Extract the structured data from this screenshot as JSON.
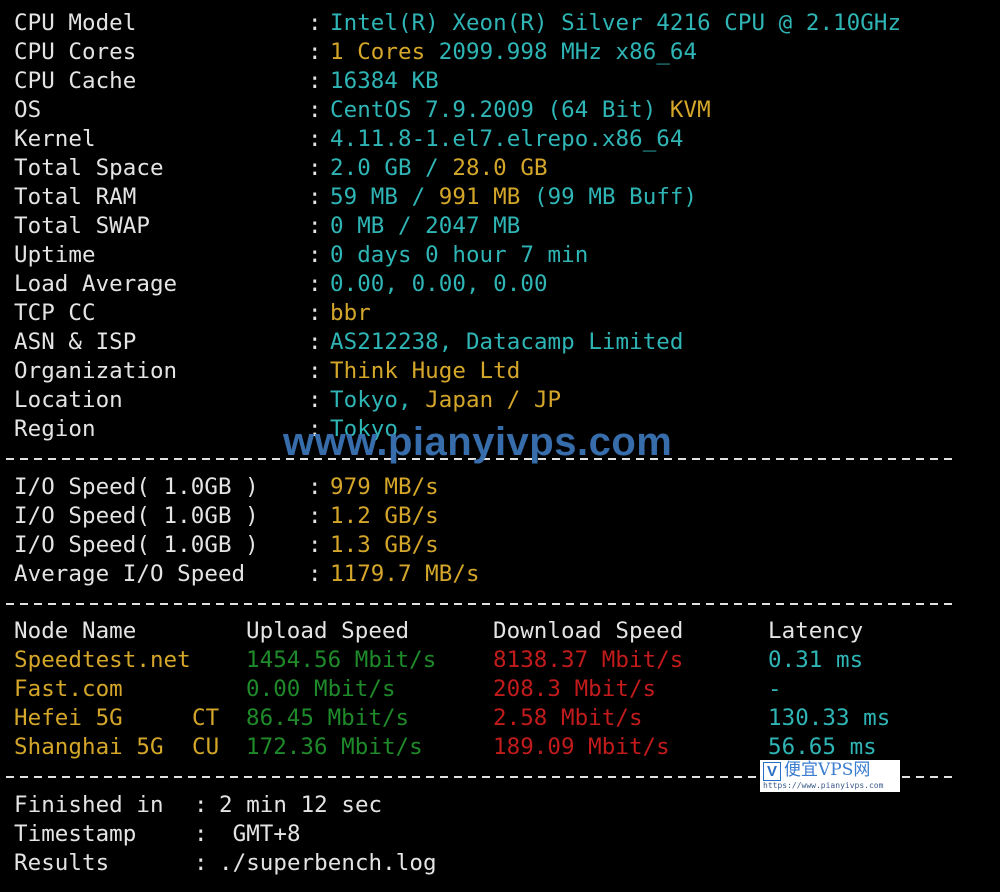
{
  "system_info": [
    {
      "label": "CPU Model",
      "parts": [
        {
          "text": "Intel(R) Xeon(R) Silver 4216 CPU @ 2.10GHz",
          "color": "cyan"
        }
      ]
    },
    {
      "label": "CPU Cores",
      "parts": [
        {
          "text": "1 Cores ",
          "color": "yellow"
        },
        {
          "text": "2099.998 MHz x86_64",
          "color": "cyan"
        }
      ]
    },
    {
      "label": "CPU Cache",
      "parts": [
        {
          "text": "16384 KB",
          "color": "cyan"
        }
      ]
    },
    {
      "label": "OS",
      "parts": [
        {
          "text": "CentOS 7.9.2009 (64 Bit) ",
          "color": "cyan"
        },
        {
          "text": "KVM",
          "color": "yellow"
        }
      ]
    },
    {
      "label": "Kernel",
      "parts": [
        {
          "text": "4.11.8-1.el7.elrepo.x86_64",
          "color": "cyan"
        }
      ]
    },
    {
      "label": "Total Space",
      "parts": [
        {
          "text": "2.0 GB / ",
          "color": "cyan"
        },
        {
          "text": "28.0 GB",
          "color": "yellow"
        }
      ]
    },
    {
      "label": "Total RAM",
      "parts": [
        {
          "text": "59 MB / ",
          "color": "cyan"
        },
        {
          "text": "991 MB ",
          "color": "yellow"
        },
        {
          "text": "(99 MB Buff)",
          "color": "cyan"
        }
      ]
    },
    {
      "label": "Total SWAP",
      "parts": [
        {
          "text": "0 MB / 2047 MB",
          "color": "cyan"
        }
      ]
    },
    {
      "label": "Uptime",
      "parts": [
        {
          "text": "0 days 0 hour 7 min",
          "color": "cyan"
        }
      ]
    },
    {
      "label": "Load Average",
      "parts": [
        {
          "text": "0.00, 0.00, 0.00",
          "color": "cyan"
        }
      ]
    },
    {
      "label": "TCP CC",
      "parts": [
        {
          "text": "bbr",
          "color": "yellow"
        }
      ]
    },
    {
      "label": "ASN & ISP",
      "parts": [
        {
          "text": "AS212238, Datacamp Limited",
          "color": "cyan"
        }
      ]
    },
    {
      "label": "Organization",
      "parts": [
        {
          "text": "Think Huge Ltd",
          "color": "yellow"
        }
      ]
    },
    {
      "label": "Location",
      "parts": [
        {
          "text": "Tokyo, ",
          "color": "cyan"
        },
        {
          "text": "Japan / JP",
          "color": "yellow"
        }
      ]
    },
    {
      "label": "Region",
      "parts": [
        {
          "text": "Tokyo",
          "color": "cyan"
        }
      ]
    }
  ],
  "separator": ":",
  "io_speed": [
    {
      "label": "I/O Speed( 1.0GB )",
      "value": "979 MB/s"
    },
    {
      "label": "I/O Speed( 1.0GB )",
      "value": "1.2 GB/s"
    },
    {
      "label": "I/O Speed( 1.0GB )",
      "value": "1.3 GB/s"
    },
    {
      "label": "Average I/O Speed",
      "value": "1179.7 MB/s"
    }
  ],
  "speedtest": {
    "headers": {
      "node": "Node Name",
      "upload": "Upload Speed",
      "download": "Download Speed",
      "latency": "Latency"
    },
    "rows": [
      {
        "node": "Speedtest.net",
        "isp": "",
        "upload": "1454.56 Mbit/s",
        "download": "8138.37 Mbit/s",
        "latency": "0.31 ms"
      },
      {
        "node": "Fast.com",
        "isp": "",
        "upload": "0.00 Mbit/s",
        "download": "208.3 Mbit/s",
        "latency": "-"
      },
      {
        "node": "Hefei 5G",
        "isp": "CT",
        "upload": "86.45 Mbit/s",
        "download": "2.58 Mbit/s",
        "latency": "130.33 ms"
      },
      {
        "node": "Shanghai 5G",
        "isp": "CU",
        "upload": "172.36 Mbit/s",
        "download": "189.09 Mbit/s",
        "latency": "56.65 ms"
      }
    ]
  },
  "summary": [
    {
      "label": "Finished in",
      "value": "2 min 12 sec"
    },
    {
      "label": "Timestamp",
      "value": " GMT+8"
    },
    {
      "label": "Results",
      "value": "./superbench.log"
    }
  ],
  "watermark": {
    "text": "www.pianyivps.com"
  },
  "badge": {
    "logo": "V",
    "title": "便宜VPS网",
    "url": "https://www.pianyivps.com"
  },
  "colors": {
    "cyan": "#2fb5b5",
    "yellow": "#d4a62a",
    "green": "#1f8a2a",
    "red": "#c21b1b",
    "white": "#e4e4e4",
    "background": "#000000"
  }
}
